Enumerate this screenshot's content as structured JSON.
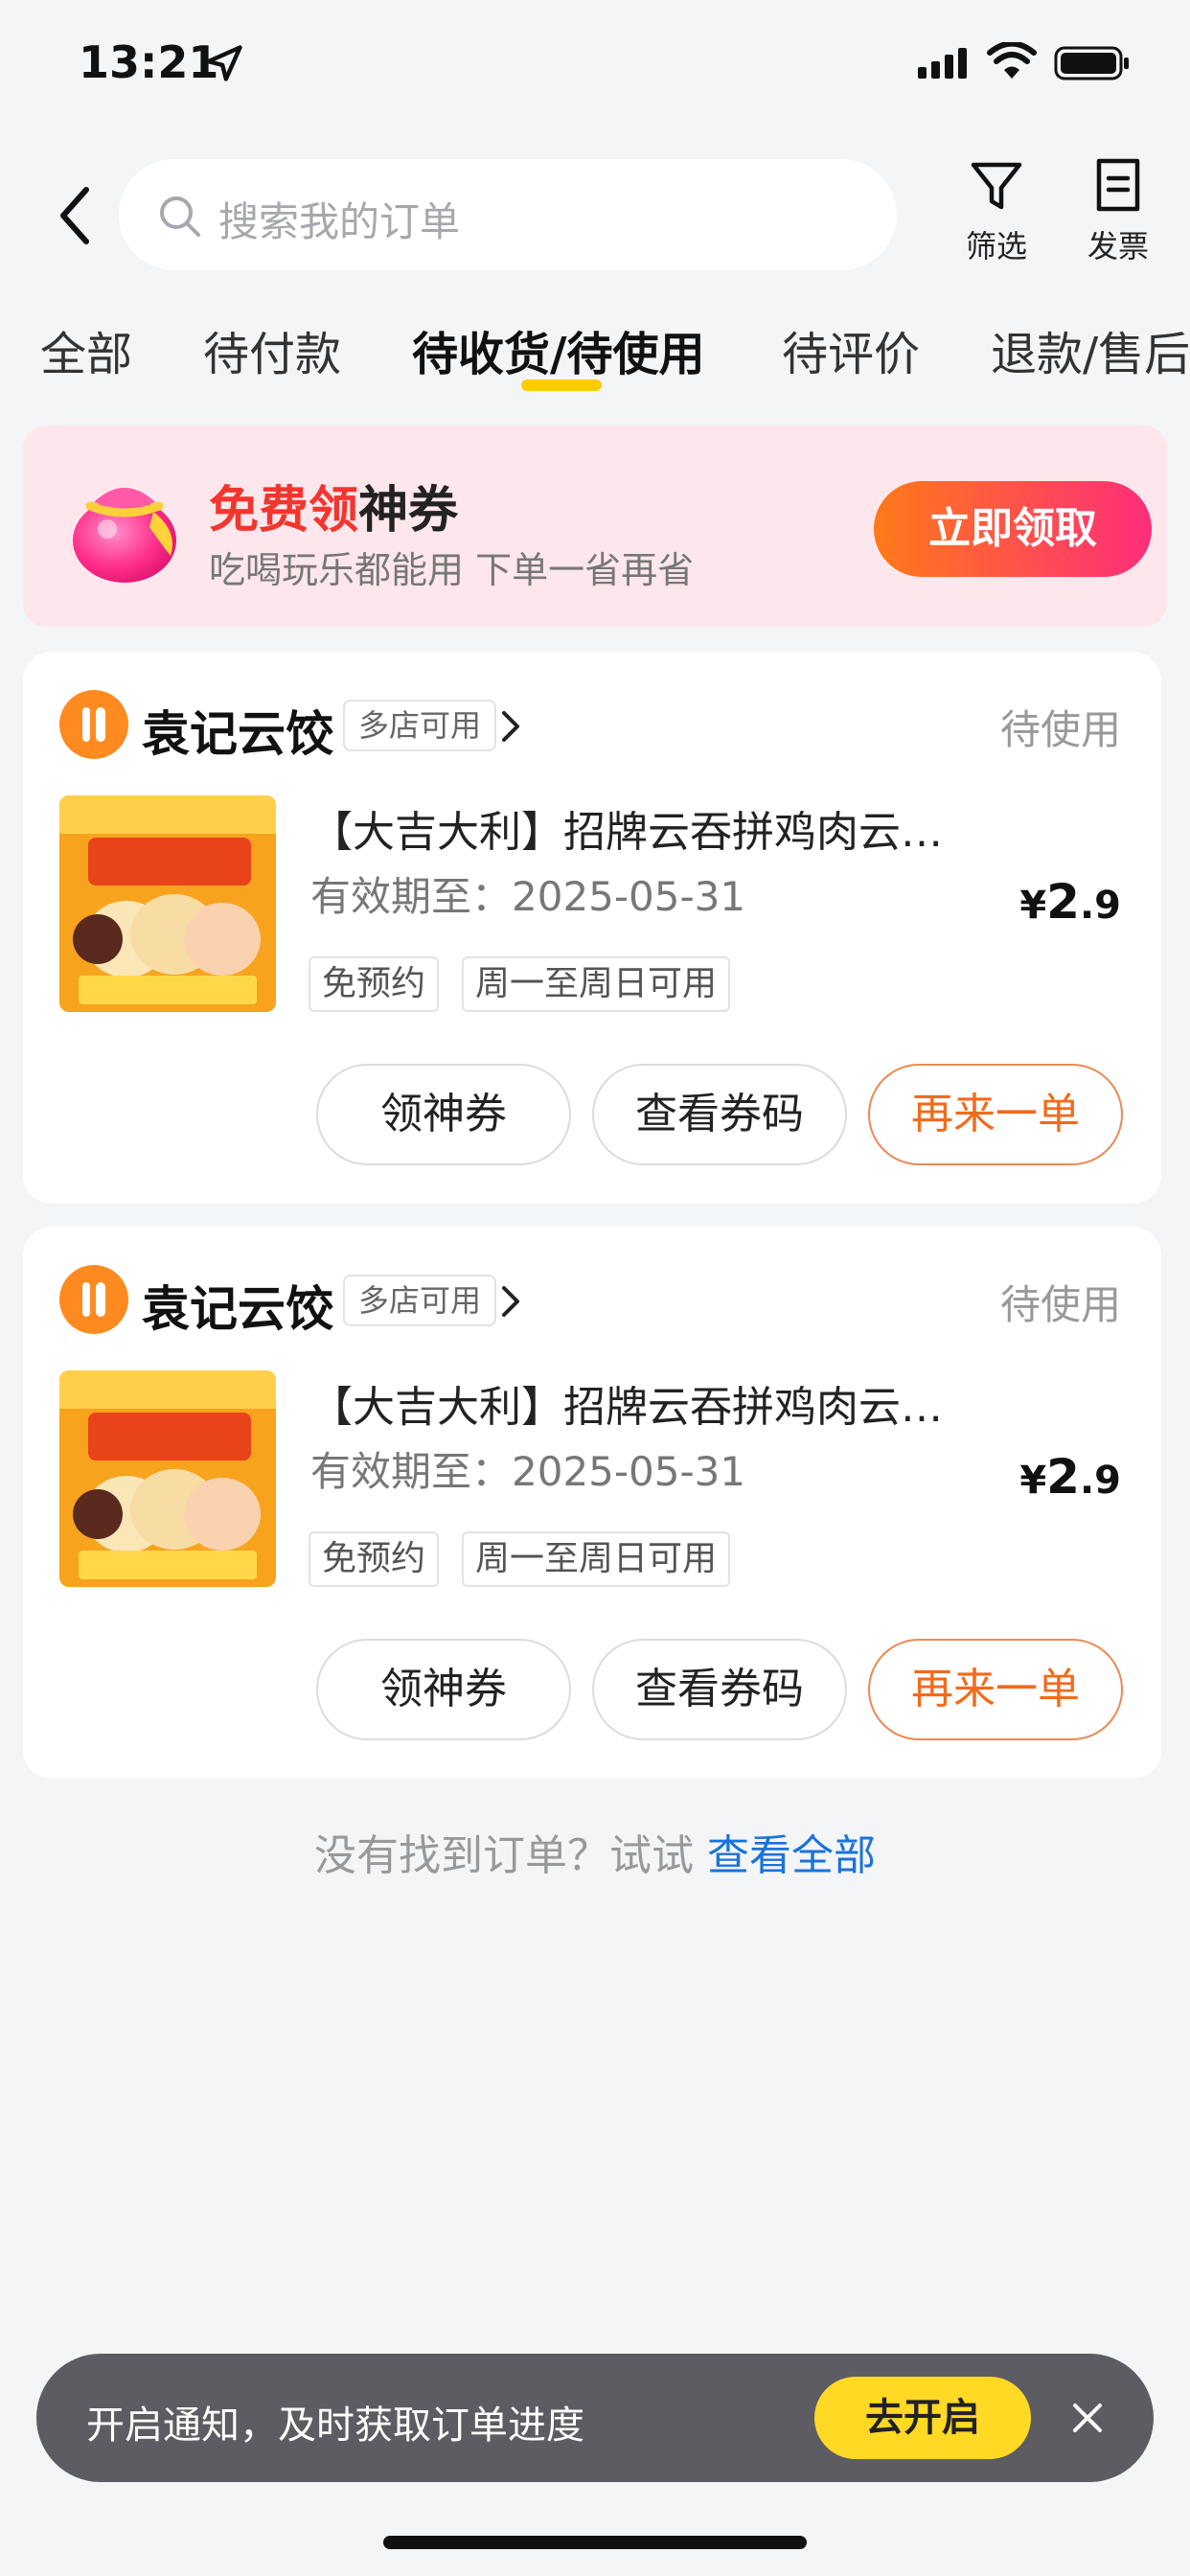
{
  "status_bar": {
    "time": "13:21"
  },
  "header": {
    "search_placeholder": "搜索我的订单",
    "filter_label": "筛选",
    "invoice_label": "发票"
  },
  "tabs": [
    {
      "label": "全部"
    },
    {
      "label": "待付款"
    },
    {
      "label": "待收货/待使用",
      "active": true
    },
    {
      "label": "待评价"
    },
    {
      "label": "退款/售后"
    }
  ],
  "promo": {
    "title_highlight": "免费领",
    "title_rest": "神券",
    "subtitle": "吃喝玩乐都能用 下单一省再省",
    "button": "立即领取"
  },
  "orders": [
    {
      "shop_name": "袁记云饺",
      "badge": "多店可用",
      "status": "待使用",
      "title": "【大吉大利】招牌云吞拼鸡肉云…",
      "expiry": "有效期至：2025-05-31",
      "price_currency": "¥",
      "price_integer": "2",
      "price_decimal": ".9",
      "tags": [
        "免预约",
        "周一至周日可用"
      ],
      "actions": [
        "领神券",
        "查看券码",
        "再来一单"
      ]
    },
    {
      "shop_name": "袁记云饺",
      "badge": "多店可用",
      "status": "待使用",
      "title": "【大吉大利】招牌云吞拼鸡肉云…",
      "expiry": "有效期至：2025-05-31",
      "price_currency": "¥",
      "price_integer": "2",
      "price_decimal": ".9",
      "tags": [
        "免预约",
        "周一至周日可用"
      ],
      "actions": [
        "领神券",
        "查看券码",
        "再来一单"
      ]
    }
  ],
  "not_found": {
    "text": "没有找到订单？试试",
    "link": "查看全部"
  },
  "toast": {
    "text": "开启通知，及时获取订单进度",
    "button": "去开启"
  },
  "colors": {
    "accent": "#ffcc00",
    "orange": "#f26a1b",
    "link": "#1a73d9",
    "promo_red": "#f2362e"
  }
}
